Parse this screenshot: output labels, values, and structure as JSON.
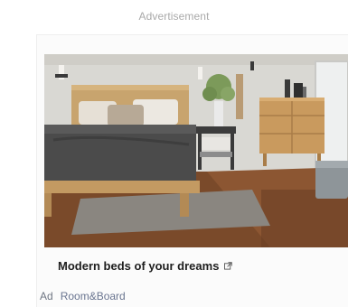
{
  "header": {
    "label": "Advertisement"
  },
  "ad": {
    "image_alt": "Bedroom with wooden platform bed, gray bedding, nightstand and dresser",
    "headline": "Modern beds of your dreams",
    "external_icon": "external-link-icon",
    "badge": "Ad",
    "advertiser": "Room&Board"
  }
}
